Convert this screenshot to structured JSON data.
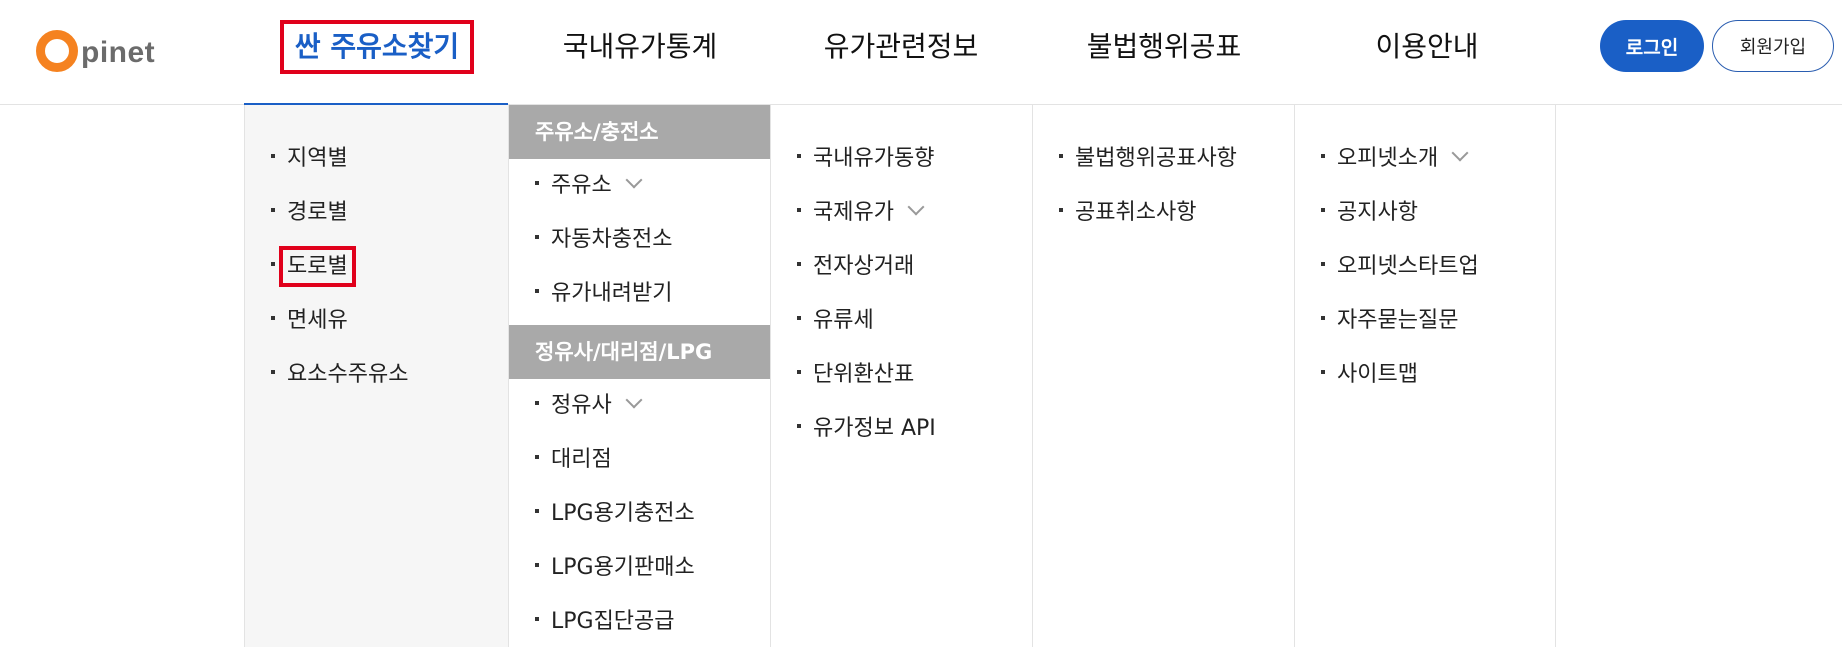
{
  "logo": {
    "letter": "O",
    "text": "pinet"
  },
  "gnb": [
    {
      "label": "싼 주유소찾기"
    },
    {
      "label": "국내유가통계"
    },
    {
      "label": "유가관련정보"
    },
    {
      "label": "불법행위공표"
    },
    {
      "label": "이용안내"
    }
  ],
  "auth": {
    "login": "로그인",
    "join": "회원가입"
  },
  "menu": {
    "col1": [
      "지역별",
      "경로별",
      "도로별",
      "면세유",
      "요소수주유소"
    ],
    "col2": {
      "group1_title": "주유소/충전소",
      "group1": [
        "주유소",
        "자동차충전소",
        "유가내려받기"
      ],
      "group2_title": "정유사/대리점/LPG",
      "group2": [
        "정유사",
        "대리점",
        "LPG용기충전소",
        "LPG용기판매소",
        "LPG집단공급"
      ]
    },
    "col3": [
      "국내유가동향",
      "국제유가",
      "전자상거래",
      "유류세",
      "단위환산표",
      "유가정보 API"
    ],
    "col4": [
      "불법행위공표사항",
      "공표취소사항"
    ],
    "col5": [
      "오피넷소개",
      "공지사항",
      "오피넷스타트업",
      "자주묻는질문",
      "사이트맵"
    ]
  },
  "colors": {
    "accent": "#1a5fc6",
    "logo_orange": "#f58220",
    "highlight": "#e0001b",
    "group_header": "#a9a9a9"
  }
}
